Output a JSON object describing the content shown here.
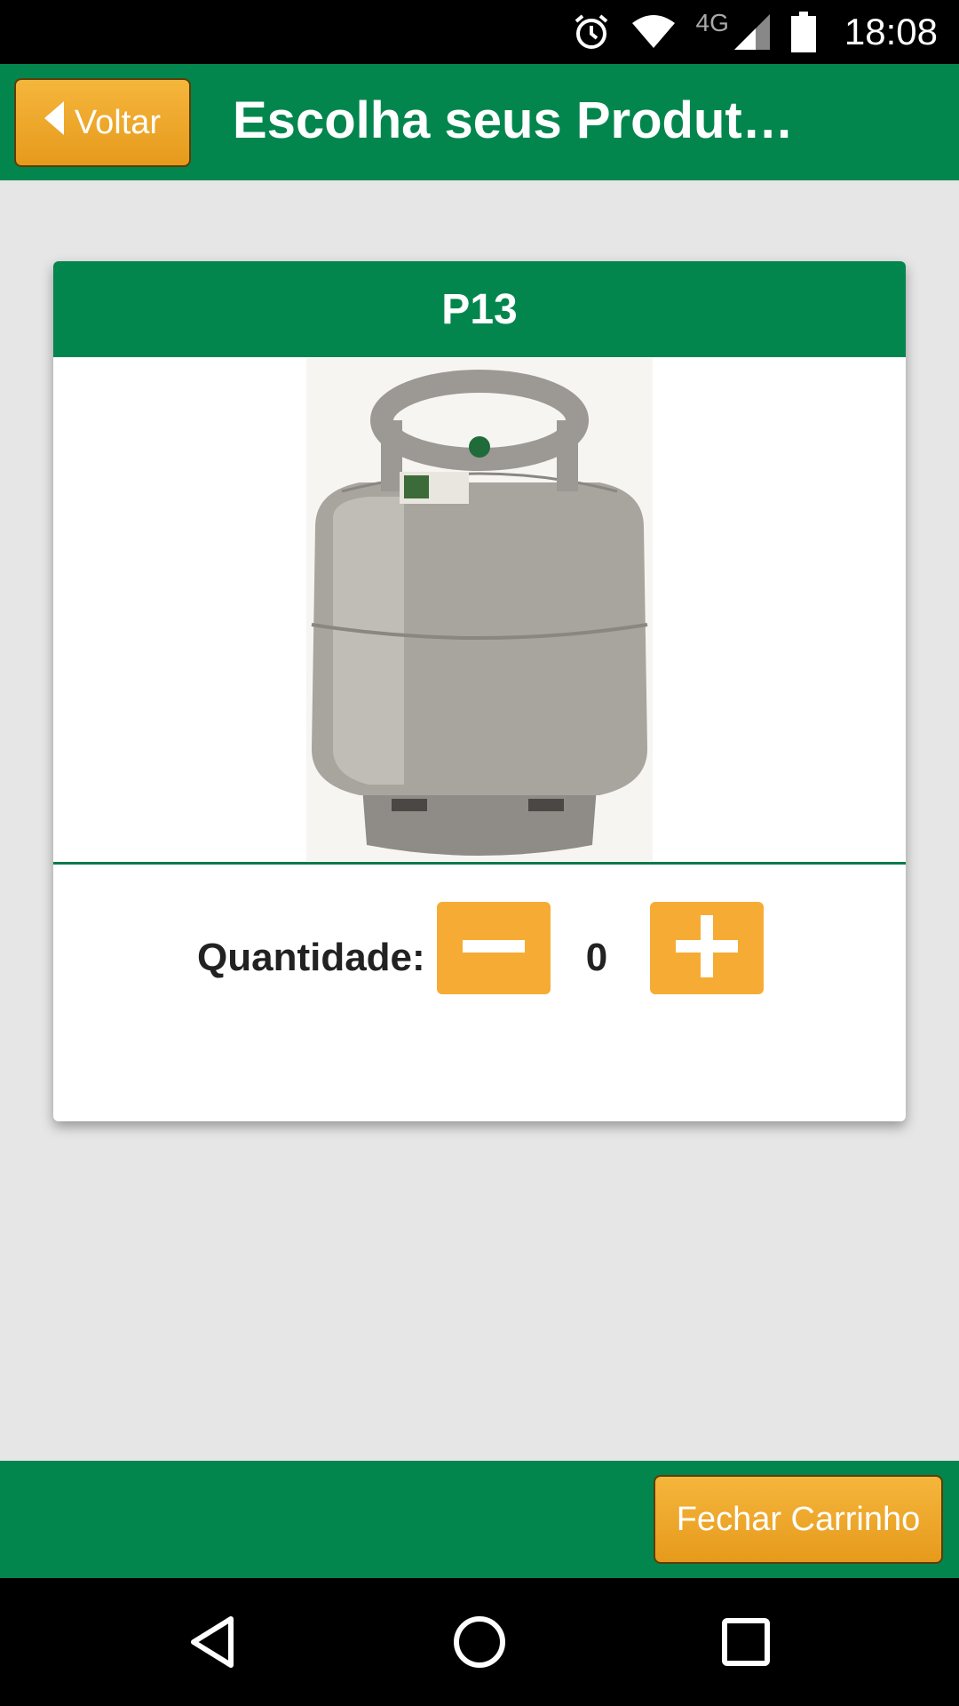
{
  "status_bar": {
    "network": "4G",
    "time": "18:08"
  },
  "header": {
    "back_label": "Voltar",
    "title": "Escolha seus Produt…"
  },
  "product": {
    "name": "P13",
    "quantity_label": "Quantidade:",
    "quantity_value": "0"
  },
  "footer": {
    "checkout_label": "Fechar Carrinho"
  },
  "colors": {
    "brand_green": "#02864d",
    "accent_orange": "#f6ac34"
  },
  "icons": [
    "alarm-icon",
    "wifi-icon",
    "signal-icon",
    "battery-icon",
    "chevron-left-icon",
    "minus-icon",
    "plus-icon",
    "nav-back-icon",
    "nav-home-icon",
    "nav-recent-icon"
  ]
}
